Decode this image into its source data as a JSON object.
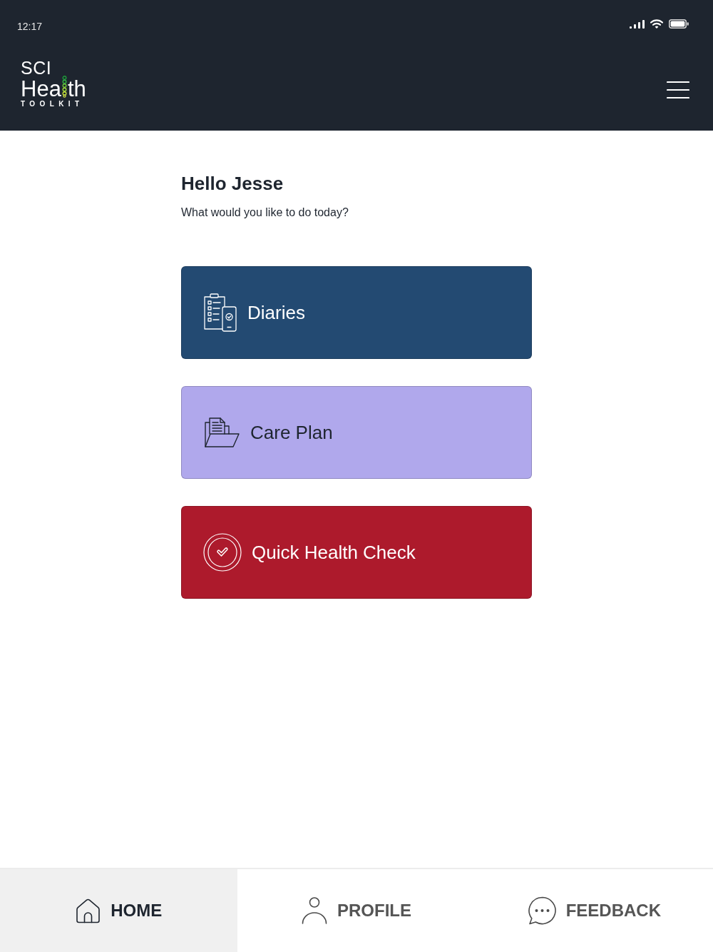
{
  "status_bar": {
    "time": "12:17"
  },
  "header": {
    "logo": {
      "top": "SCI",
      "word_start": "Hea",
      "word_end": "th",
      "bottom": "TOOLKIT"
    }
  },
  "greeting": {
    "title": "Hello Jesse",
    "subtitle": "What would you like to do today?"
  },
  "actions": [
    {
      "label": "Diaries",
      "kind": "diaries",
      "color": "#234a72"
    },
    {
      "label": "Care Plan",
      "kind": "care_plan",
      "color": "#b0a8ec"
    },
    {
      "label": "Quick Health Check",
      "kind": "health_check",
      "color": "#ad1a2c"
    }
  ],
  "bottom_nav": [
    {
      "label": "HOME",
      "kind": "home",
      "selected": true
    },
    {
      "label": "PROFILE",
      "kind": "profile",
      "selected": false
    },
    {
      "label": "FEEDBACK",
      "kind": "feedback",
      "selected": false
    }
  ]
}
